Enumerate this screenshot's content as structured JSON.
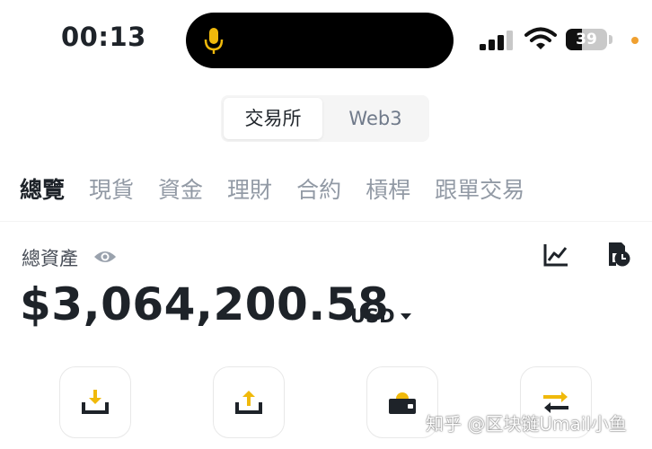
{
  "status_bar": {
    "time": "00:13",
    "battery_level": "39",
    "battery_fraction": 0.39,
    "mic_color": "#f0b90b",
    "icons": [
      "microphone-icon",
      "signal-icon",
      "wifi-icon",
      "battery-icon"
    ]
  },
  "segment": {
    "items": [
      {
        "label": "交易所",
        "active": true
      },
      {
        "label": "Web3",
        "active": false
      }
    ]
  },
  "tabs": [
    {
      "label": "總覽",
      "active": true
    },
    {
      "label": "現貨",
      "active": false
    },
    {
      "label": "資金",
      "active": false
    },
    {
      "label": "理財",
      "active": false
    },
    {
      "label": "合約",
      "active": false
    },
    {
      "label": "槓桿",
      "active": false
    },
    {
      "label": "跟單交易",
      "active": false
    }
  ],
  "balance": {
    "label": "總資產",
    "amount": "$3,064,200.58",
    "currency": "USD",
    "icons": [
      "eye-icon",
      "chart-icon",
      "history-icon"
    ]
  },
  "actions": {
    "icons": [
      "deposit-icon",
      "withdraw-icon",
      "wallet-icon",
      "transfer-icon"
    ]
  },
  "colors": {
    "accent": "#f0b90b",
    "text_primary": "#1e2329",
    "text_secondary": "#929aa5"
  },
  "watermark": "知乎 @区块链Umail小鱼"
}
